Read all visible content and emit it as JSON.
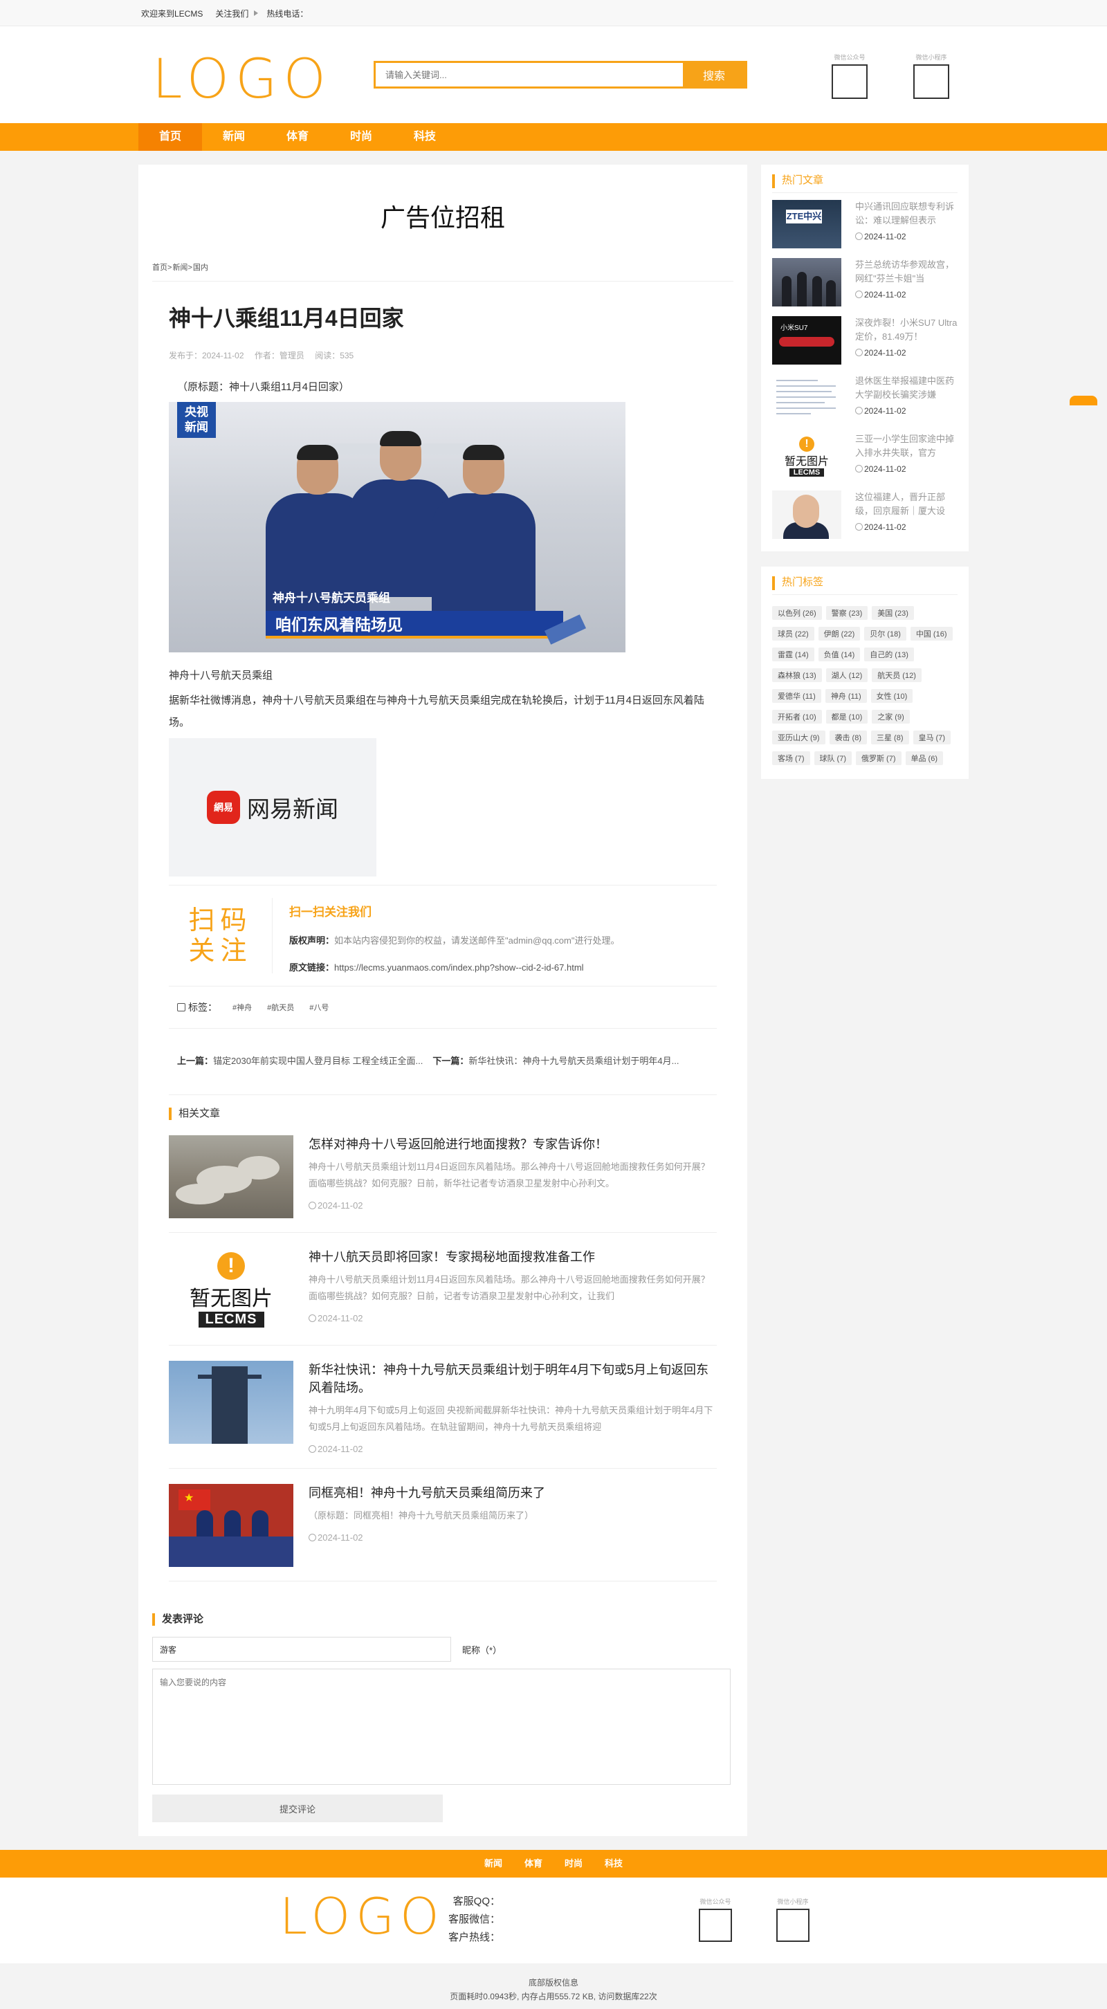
{
  "topbar": {
    "welcome": "欢迎来到LECMS",
    "follow": "关注我们",
    "hotline": "热线电话："
  },
  "header": {
    "logo": "LOGO",
    "search_placeholder": "请输入关键词...",
    "search_button": "搜索",
    "qr1_label": "微信公众号",
    "qr2_label": "微信小程序"
  },
  "nav": {
    "items": [
      "首页",
      "新闻",
      "体育",
      "时尚",
      "科技"
    ]
  },
  "ad": {
    "title": "广告位招租"
  },
  "breadcrumb": {
    "home": "首页",
    "sep": ">",
    "news": "新闻",
    "domestic": "国内"
  },
  "article": {
    "title": "神十八乘组11月4日回家",
    "date": "发布于：2024-11-02",
    "author": "作者：管理员",
    "views": "阅读：535",
    "subtitle": "（原标题：神十八乘组11月4日回家）",
    "photo_badge_line1": "央视",
    "photo_badge_line2": "新闻",
    "photo_caption1": "神舟十八号航天员乘组",
    "photo_caption2": "咱们东风着陆场见",
    "para1": "神舟十八号航天员乘组",
    "para2": "据新华社微博消息，神舟十八号航天员乘组在与神舟十九号航天员乘组完成在轨轮换后，计划于11月4日返回东风着陆场。",
    "netease_logo": "網易",
    "netease_text": "网易新闻"
  },
  "follow": {
    "qr_text_line1": "扫码",
    "qr_text_line2": "关注",
    "title": "扫一扫关注我们",
    "copyright_label": "版权声明：",
    "copyright_text": "如本站内容侵犯到你的权益，请发送邮件至\"admin@qq.com\"进行处理。",
    "link_label": "原文链接：",
    "link_text": "https://lecms.yuanmaos.com/index.php?show--cid-2-id-67.html"
  },
  "tags": {
    "label": "标签：",
    "items": [
      "#神舟",
      "#航天员",
      "#八号"
    ]
  },
  "prevnext": {
    "prev_label": "上一篇：",
    "prev_text": "锚定2030年前实现中国人登月目标 工程全线正全面...",
    "next_label": "下一篇：",
    "next_text": "新华社快讯：神舟十九号航天员乘组计划于明年4月..."
  },
  "related": {
    "title": "相关文章",
    "items": [
      {
        "title": "怎样对神舟十八号返回舱进行地面搜救？专家告诉你！",
        "desc": "神舟十八号航天员乘组计划11月4日返回东风着陆场。那么神舟十八号返回舱地面搜救任务如何开展？面临哪些挑战？如何克服？日前，新华社记者专访酒泉卫星发射中心孙利文。",
        "date": "2024-11-02"
      },
      {
        "title": "神十八航天员即将回家！专家揭秘地面搜救准备工作",
        "desc": "神舟十八号航天员乘组计划11月4日返回东风着陆场。那么神舟十八号返回舱地面搜救任务如何开展？面临哪些挑战？如何克服？日前，记者专访酒泉卫星发射中心孙利文，让我们",
        "date": "2024-11-02",
        "noimg_title": "暂无图片",
        "noimg_brand": "LECMS"
      },
      {
        "title": "新华社快讯：神舟十九号航天员乘组计划于明年4月下旬或5月上旬返回东风着陆场。",
        "desc": "神十九明年4月下旬或5月上旬返回 央视新闻截屏新华社快讯：神舟十九号航天员乘组计划于明年4月下旬或5月上旬返回东风着陆场。在轨驻留期间，神舟十九号航天员乘组将迎",
        "date": "2024-11-02"
      },
      {
        "title": "同框亮相！神舟十九号航天员乘组简历来了",
        "desc": "（原标题：同框亮相！神舟十九号航天员乘组简历来了）",
        "date": "2024-11-02"
      }
    ]
  },
  "comment": {
    "title": "发表评论",
    "nick_value": "游客",
    "nick_label": "昵称（*）",
    "content_placeholder": "输入您要说的内容",
    "submit": "提交评论"
  },
  "hot": {
    "title": "热门文章",
    "items": [
      {
        "title": "中兴通讯回应联想专利诉讼：难以理解但表示",
        "date": "2024-11-02",
        "thumb_text": "ZTE中兴"
      },
      {
        "title": "芬兰总统访华参观故宫，网红\"芬兰卡姐\"当",
        "date": "2024-11-02"
      },
      {
        "title": "深夜炸裂！小米SU7 Ultra定价，81.49万！",
        "date": "2024-11-02",
        "thumb_text": "小米SU7"
      },
      {
        "title": "退休医生举报福建中医药大学副校长骗奖涉嫌",
        "date": "2024-11-02"
      },
      {
        "title": "三亚一小学生回家途中掉入排水井失联，官方",
        "date": "2024-11-02",
        "noimg_title": "暂无图片",
        "noimg_brand": "LECMS"
      },
      {
        "title": "这位福建人，晋升正部级，回京履新｜厦大设",
        "date": "2024-11-02"
      }
    ]
  },
  "tagcloud": {
    "title": "热门标签",
    "items": [
      "以色列 (26)",
      "警察 (23)",
      "美国 (23)",
      "球员 (22)",
      "伊朗 (22)",
      "贝尔 (18)",
      "中国 (16)",
      "雷霆 (14)",
      "负值 (14)",
      "自己的 (13)",
      "森林狼 (13)",
      "湖人 (12)",
      "航天员 (12)",
      "爱德华 (11)",
      "神舟 (11)",
      "女性 (10)",
      "开拓者 (10)",
      "都是 (10)",
      "之家 (9)",
      "亚历山大 (9)",
      "袭击 (8)",
      "三星 (8)",
      "皇马 (7)",
      "客场 (7)",
      "球队 (7)",
      "俄罗斯 (7)",
      "单品 (6)"
    ]
  },
  "footer": {
    "nav": [
      "新闻",
      "体育",
      "时尚",
      "科技"
    ],
    "logo": "LOGO",
    "qq": "客服QQ：",
    "wechat": "客服微信：",
    "hotline": "客户热线：",
    "qr1_label": "微信公众号",
    "qr2_label": "微信小程序",
    "copyright": "底部版权信息",
    "stats": "页面耗时0.0943秒, 内存占用555.72 KB, 访问数据库22次"
  },
  "colors": {
    "accent": "#fd9c07",
    "accent_dark": "#f58201",
    "logo": "#f7a318"
  }
}
